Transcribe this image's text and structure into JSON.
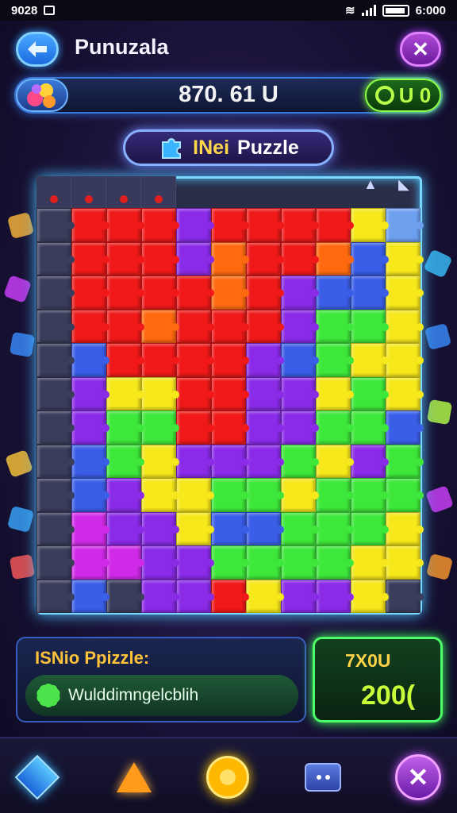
{
  "status_bar": {
    "time": "9028",
    "clock": "6:000"
  },
  "header": {
    "title": "Punuzala",
    "back_icon": "back-arrow-icon",
    "close_icon": "close-icon",
    "close_glyph": "✕"
  },
  "stats": {
    "score": "870. 61 U",
    "coins": "U 0",
    "gems_icon": "gem-bundle-icon"
  },
  "puzzle_tag": {
    "accent": "INei",
    "label": "Puzzle",
    "icon": "puzzle-piece-icon"
  },
  "board": {
    "columns": 11,
    "rows": 12,
    "colors": {
      "R": "#f01818",
      "O": "#ff6a10",
      "Y": "#f6e81a",
      "G": "#3ee83a",
      "P": "#8a2be8",
      "B": "#3a5ee8",
      "M": "#d02ae8",
      "K": "#3a3d5c",
      "L": "#6ea0f0"
    },
    "pieces": [
      "KRRRPRRRRYL",
      "KRRRPORROBY",
      "KRRRRORPBBY",
      "KRRORRRPGGY",
      "KBRRRRPBGYY",
      "KPYYRRPPYGY",
      "KPGGRRPPGGB",
      "KBGYPPPGYPG",
      "KBPYYGGYGGG",
      "KMPPYBBGGGY",
      "KMMPPGGGGYY",
      "KBKPPRYPPYK"
    ]
  },
  "info_panel": {
    "title": "ISNio Ppizzle:",
    "subtitle": "Wulddimngelcblih"
  },
  "reward": {
    "label": "7X0U",
    "value": "200("
  },
  "toolbar": {
    "close_glyph": "✕"
  },
  "colors": {
    "accent_blue": "#4fc4ff",
    "accent_green": "#4cff6a",
    "accent_gold": "#ffc23a",
    "accent_purple": "#c050ff"
  }
}
